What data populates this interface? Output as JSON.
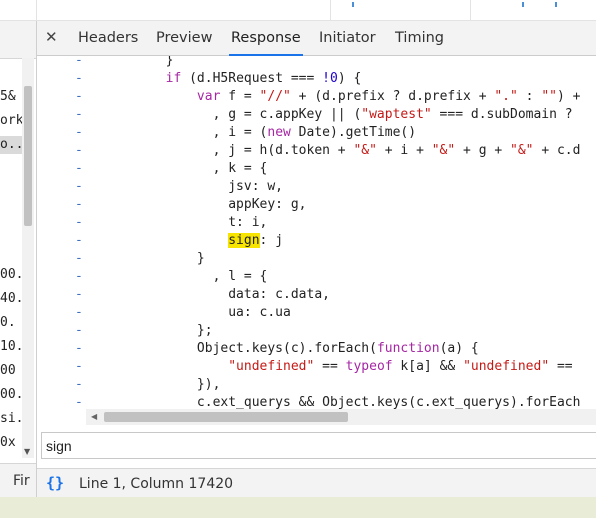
{
  "left_list": {
    "rows": [
      "5&",
      "ork",
      "o..",
      "",
      "",
      "00.",
      "40.",
      "0.",
      "10.",
      "00",
      "00.",
      "si..",
      "0x"
    ],
    "filter_label": "Fir"
  },
  "tabs": {
    "close_glyph": "✕",
    "items": [
      {
        "label": "Headers",
        "active": false
      },
      {
        "label": "Preview",
        "active": false
      },
      {
        "label": "Response",
        "active": true
      },
      {
        "label": "Initiator",
        "active": false
      },
      {
        "label": "Timing",
        "active": false
      }
    ]
  },
  "code": {
    "gutter_mark": "-",
    "lines": [
      [
        {
          "t": "        }",
          "c": "id"
        }
      ],
      [
        {
          "t": "        ",
          "c": "id"
        },
        {
          "t": "if",
          "c": "kw"
        },
        {
          "t": " (d.H5Request === ",
          "c": "id"
        },
        {
          "t": "!0",
          "c": "num"
        },
        {
          "t": ") {",
          "c": "id"
        }
      ],
      [
        {
          "t": "            ",
          "c": "id"
        },
        {
          "t": "var",
          "c": "kw"
        },
        {
          "t": " f = ",
          "c": "id"
        },
        {
          "t": "\"//\"",
          "c": "str"
        },
        {
          "t": " + (d.prefix ? d.prefix + ",
          "c": "id"
        },
        {
          "t": "\".\"",
          "c": "str"
        },
        {
          "t": " : ",
          "c": "id"
        },
        {
          "t": "\"\"",
          "c": "str"
        },
        {
          "t": ") +",
          "c": "id"
        }
      ],
      [
        {
          "t": "              , g = c.appKey || (",
          "c": "id"
        },
        {
          "t": "\"waptest\"",
          "c": "str"
        },
        {
          "t": " === d.subDomain ?",
          "c": "id"
        }
      ],
      [
        {
          "t": "              , i = (",
          "c": "id"
        },
        {
          "t": "new",
          "c": "kw"
        },
        {
          "t": " Date).getTime()",
          "c": "id"
        }
      ],
      [
        {
          "t": "              , j = h(d.token + ",
          "c": "id"
        },
        {
          "t": "\"&\"",
          "c": "str"
        },
        {
          "t": " + i + ",
          "c": "id"
        },
        {
          "t": "\"&\"",
          "c": "str"
        },
        {
          "t": " + g + ",
          "c": "id"
        },
        {
          "t": "\"&\"",
          "c": "str"
        },
        {
          "t": " + c.d",
          "c": "id"
        }
      ],
      [
        {
          "t": "              , k = {",
          "c": "id"
        }
      ],
      [
        {
          "t": "                jsv: w,",
          "c": "id"
        }
      ],
      [
        {
          "t": "                appKey: g,",
          "c": "id"
        }
      ],
      [
        {
          "t": "                t: i,",
          "c": "id"
        }
      ],
      [
        {
          "t": "                ",
          "c": "id"
        },
        {
          "t": "sign",
          "c": "hl"
        },
        {
          "t": ": j",
          "c": "id"
        }
      ],
      [
        {
          "t": "            }",
          "c": "id"
        }
      ],
      [
        {
          "t": "              , l = {",
          "c": "id"
        }
      ],
      [
        {
          "t": "                data: c.data,",
          "c": "id"
        }
      ],
      [
        {
          "t": "                ua: c.ua",
          "c": "id"
        }
      ],
      [
        {
          "t": "            };",
          "c": "id"
        }
      ],
      [
        {
          "t": "            Object.keys(c).forEach(",
          "c": "id"
        },
        {
          "t": "function",
          "c": "kw"
        },
        {
          "t": "(a) {",
          "c": "id"
        }
      ],
      [
        {
          "t": "                ",
          "c": "id"
        },
        {
          "t": "\"undefined\"",
          "c": "str"
        },
        {
          "t": " == ",
          "c": "id"
        },
        {
          "t": "typeof",
          "c": "kw"
        },
        {
          "t": " k[a] && ",
          "c": "id"
        },
        {
          "t": "\"undefined\"",
          "c": "str"
        },
        {
          "t": " ==",
          "c": "id"
        }
      ],
      [
        {
          "t": "            }),",
          "c": "id"
        }
      ],
      [
        {
          "t": "            c.ext_querys && Object.keys(c.ext_querys).forEach",
          "c": "id"
        }
      ]
    ]
  },
  "search": {
    "value": "sign"
  },
  "status": {
    "pretty_print_glyph": "{}",
    "position_text": "Line 1, Column 17420"
  },
  "colors": {
    "accent": "#1a73e8",
    "keyword": "#a626a4",
    "string": "#c41a16",
    "number": "#1c00cf",
    "highlight": "#f7e400"
  }
}
